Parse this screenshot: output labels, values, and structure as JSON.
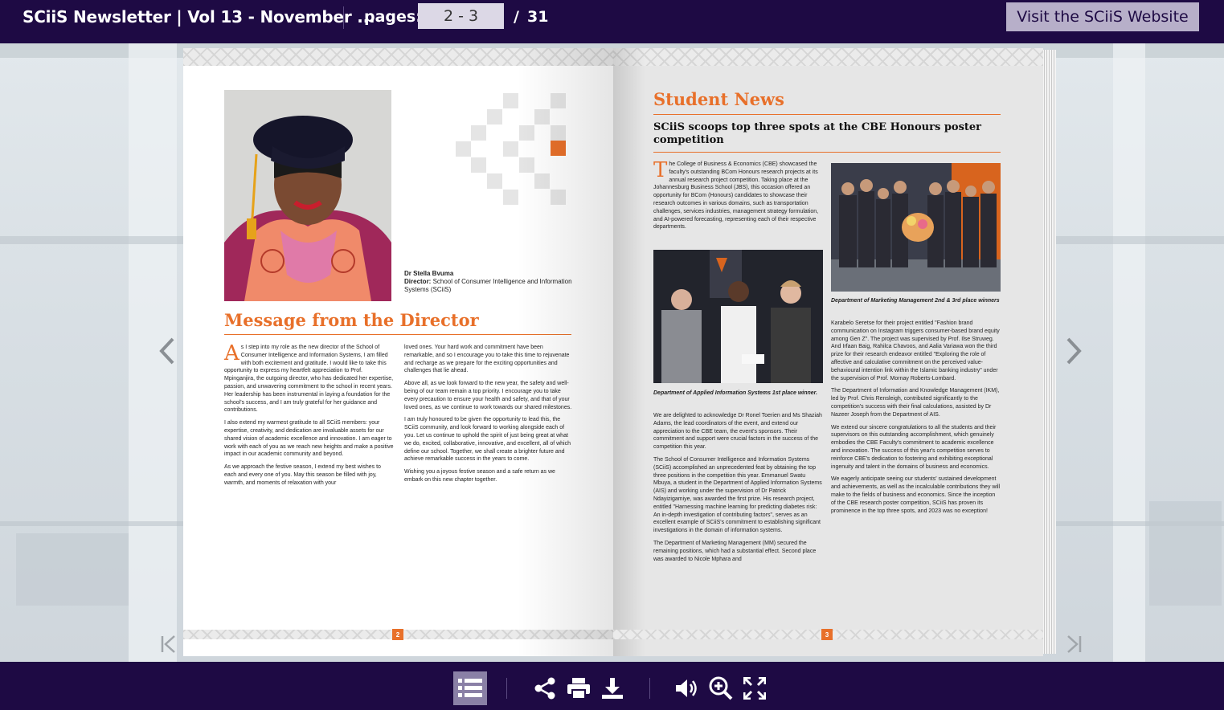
{
  "topbar": {
    "title": "SCiiS Newsletter | Vol 13 - November ...",
    "pages_label": "pages:",
    "page_value": "2 - 3",
    "separator": "/",
    "total_pages": "31",
    "visit_label": "Visit the SCiiS Website"
  },
  "left_page": {
    "caption_name": "Dr Stella Bvuma",
    "caption_role_label": "Director:",
    "caption_role": " School of Consumer Intelligence and Information Systems (SCiiS)",
    "heading": "Message from the Director",
    "col1": [
      "s I step into my role as the new director of the School of Consumer Intelligence and Information Systems, I am filled with both excitement and gratitude. I would like to take this opportunity to express my heartfelt appreciation to Prof. Mpinganjira, the outgoing director, who has dedicated her expertise, passion, and unwavering commitment to the school in recent years. Her leadership has been instrumental in laying a foundation for the school's success, and I am truly grateful for her guidance and contributions.",
      "I also extend my warmest gratitude to all SCiiS members: your expertise, creativity, and dedication are invaluable assets for our shared vision of academic excellence and innovation. I am eager to work with each of you as we reach new heights and make a positive impact in our academic community and beyond.",
      "As we approach the festive season, I extend my best wishes to each and every one of you. May this season be filled with joy, warmth, and moments of relaxation with your"
    ],
    "col1_dropcap": "A",
    "col2": [
      "loved ones. Your hard work and commitment have been remarkable, and so I encourage you to take this time to rejuvenate and recharge as we prepare for the exciting opportunities and challenges that lie ahead.",
      "Above all, as we look forward to the new year, the safety and well-being of our team remain a top priority. I encourage you to take every precaution to ensure your health and safety, and that of your loved ones, as we continue to work towards our shared milestones.",
      "I am truly honoured to be given the opportunity to lead this, the SCiiS community, and look forward to working alongside each of you. Let us continue to uphold the spirit of just being great at what we do, excited, collaborative, innovative, and excellent, all of which define our school. Together, we shall create a brighter future and achieve remarkable success in the years to come.",
      "Wishing you a joyous festive season and a safe return as we embark on this new chapter together."
    ],
    "page_number": "2"
  },
  "right_page": {
    "heading": "Student News",
    "subheading": "SCiiS scoops top three spots at the CBE Honours poster competition",
    "intro_dropcap": "T",
    "intro": "he College of Business & Economics (CBE) showcased the faculty's outstanding BCom Honours research projects at its annual research project competition. Taking place at the Johannesburg Business School (JBS), this occasion offered an opportunity for BCom (Honours) candidates to showcase their research outcomes in various domains, such as transportation challenges, services industries, management strategy formulation, and AI-powered forecasting, representing each of their respective departments.",
    "photo1_caption": "Department of Marketing Management 2nd & 3rd place winners",
    "photo2_caption": "Department of Applied Information Systems 1st place winner.",
    "colA": [
      "We are delighted to acknowledge Dr Ronel Toerien and Ms Shaziah Adams, the lead coordinators of the event, and extend our appreciation to the CBE team, the event's sponsors. Their commitment and support were crucial factors in the success of the competition this year.",
      "The School of Consumer Intelligence and Information Systems (SCiiS) accomplished an unprecedented feat by obtaining the top three positions in the competition this year. Emmanuel Swatu Mbuya, a student in the Department of Applied Information Systems (AIS) and working under the supervision of Dr Patrick Ndayizigamiye, was awarded the first prize. His research project, entitled \"Harnessing machine learning for predicting diabetes risk: An in-depth investigation of contributing factors\", serves as an excellent example of SCiiS's commitment to establishing significant investigations in the domain of information systems.",
      "The Department of Marketing Management (MM) secured the remaining positions, which had a substantial effect. Second place was awarded to Nicole Mphara and"
    ],
    "colB": [
      "Karabelo Seretse for their project entitled \"Fashion brand communication on Instagram triggers consumer-based brand equity among Gen Z\". The project was supervised by Prof. Ilse Struweg. And Irfaan Baig, Rahilca Chavoos, and Aalia Variawa won the third prize for their research endeavor entitled \"Exploring the role of affective and calculative commitment on the perceived value-behavioural intention link within the Islamic banking industry\" under the supervision of Prof. Mornay Roberts-Lombard.",
      "The Department of Information and Knowledge Management (IKM), led by Prof. Chris Rensleigh, contributed significantly to the competition's success with their final calculations, assisted by Dr Nazeer Joseph from the Department of AIS.",
      "We extend our sincere congratulations to all the students and their supervisors on this outstanding accomplishment, which genuinely embodies the CBE Faculty's commitment to academic excellence and innovation. The success of this year's competition serves to reinforce CBE's dedication to fostering and exhibiting exceptional ingenuity and talent in the domains of business and economics.",
      "We eagerly anticipate seeing our students' sustained development and achievements, as well as the incalculable contributions they will make to the fields of business and economics. Since the inception of the CBE research poster competition, SCiiS has proven its prominence in the top three spots, and 2023 was no exception!"
    ],
    "page_number": "3"
  },
  "toolbar": {
    "icons": [
      "list-icon",
      "share-icon",
      "print-icon",
      "download-icon",
      "volume-icon",
      "zoom-in-icon",
      "fullscreen-icon"
    ]
  },
  "colors": {
    "brand": "#1e0a44",
    "accent": "#e8702a",
    "button_bg": "#b7afc9"
  }
}
